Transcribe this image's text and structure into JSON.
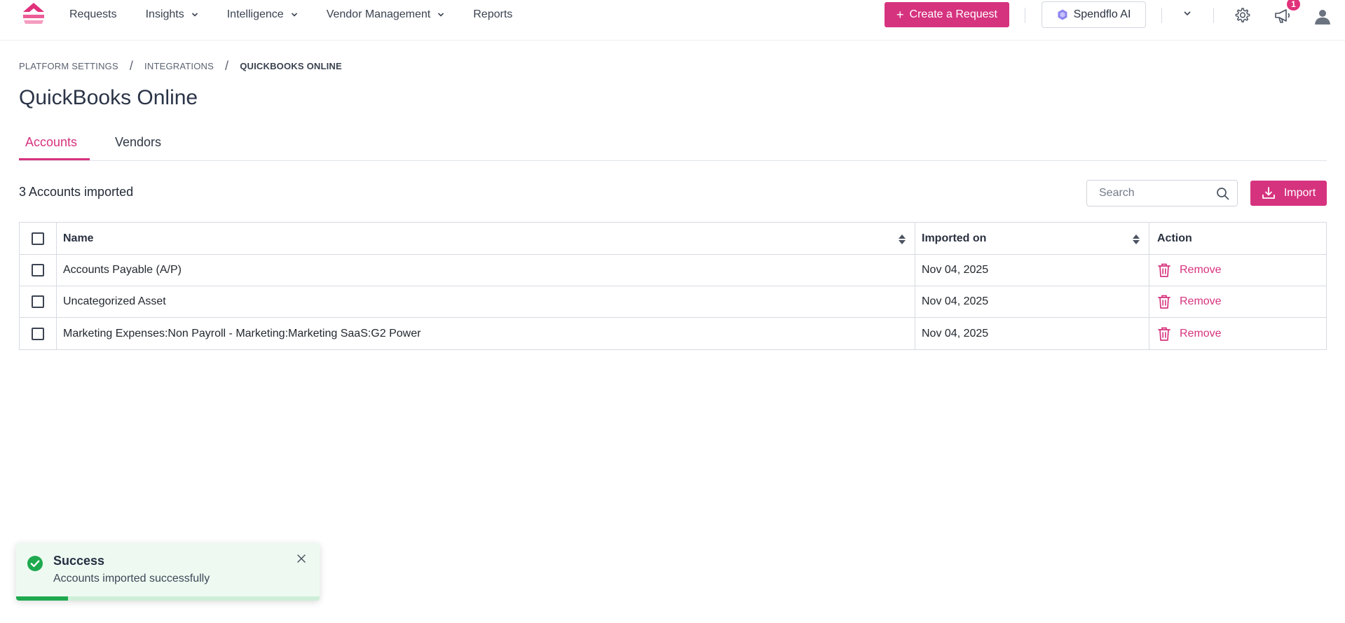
{
  "nav": {
    "items": [
      {
        "label": "Requests",
        "has_dropdown": false
      },
      {
        "label": "Insights",
        "has_dropdown": true
      },
      {
        "label": "Intelligence",
        "has_dropdown": true
      },
      {
        "label": "Vendor Management",
        "has_dropdown": true
      },
      {
        "label": "Reports",
        "has_dropdown": false
      }
    ],
    "create_button": "Create a Request",
    "ai_button": "Spendflo AI",
    "notification_count": "1",
    "icons": [
      "logo-icon",
      "chevron-down-icon",
      "gear-icon",
      "megaphone-icon",
      "user-avatar-icon"
    ]
  },
  "breadcrumb": {
    "items": [
      "PLATFORM SETTINGS",
      "INTEGRATIONS"
    ],
    "current": "QUICKBOOKS ONLINE"
  },
  "page": {
    "title": "QuickBooks Online"
  },
  "tabs": [
    {
      "label": "Accounts",
      "active": true
    },
    {
      "label": "Vendors",
      "active": false
    }
  ],
  "toolbar": {
    "count_label": "3 Accounts imported",
    "search_placeholder": "Search",
    "import_label": "Import"
  },
  "table": {
    "columns": [
      "Name",
      "Imported on",
      "Action"
    ],
    "rows": [
      {
        "name": "Accounts Payable (A/P)",
        "imported_on": "Nov 04, 2025",
        "action": "Remove"
      },
      {
        "name": "Uncategorized Asset",
        "imported_on": "Nov 04, 2025",
        "action": "Remove"
      },
      {
        "name": "Marketing Expenses:Non Payroll - Marketing:Marketing SaaS:G2 Power",
        "imported_on": "Nov 04, 2025",
        "action": "Remove"
      }
    ]
  },
  "toast": {
    "title": "Success",
    "message": "Accounts imported successfully",
    "progress": 0.17
  },
  "colors": {
    "accent": "#d6337f",
    "success": "#1ea94f",
    "toast_bg": "#eefaf1"
  }
}
